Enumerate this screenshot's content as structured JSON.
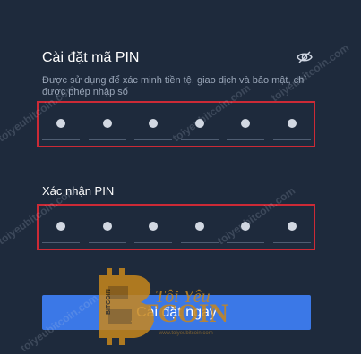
{
  "form": {
    "title": "Cài đặt mã PIN",
    "description": "Được sử dụng để xác minh tiền tệ, giao dịch và bảo mật, chỉ được phép nhập số",
    "pin_slots": 6,
    "confirm_label": "Xác nhận PIN",
    "submit_label": "Cài đặt ngay"
  },
  "watermark": {
    "text": "toiyeubitcoin.com",
    "logo_text": "Tôi Yêu",
    "logo_word": "ITCOIN",
    "logo_badge": "BITCOIN",
    "logo_url": "www.toiyeubitcoin.com"
  },
  "colors": {
    "background": "#1e2a3c",
    "accent": "#3b78e7",
    "highlight": "#cc2a36"
  }
}
